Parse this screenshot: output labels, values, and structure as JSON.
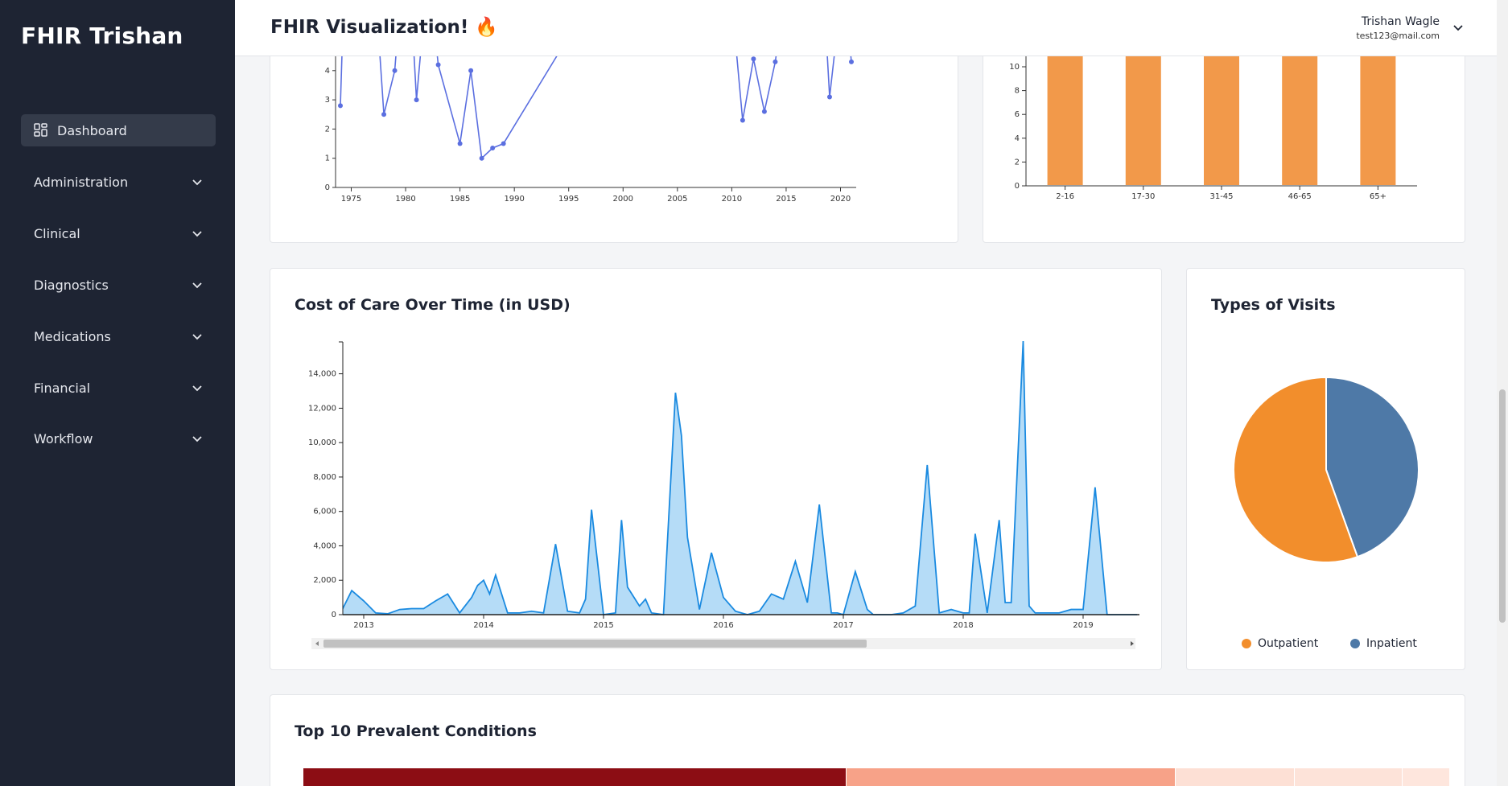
{
  "app": {
    "brand": "FHIR Trishan"
  },
  "header": {
    "title": "FHIR Visualization! 🔥",
    "user_name": "Trishan Wagle",
    "user_email": "test123@mail.com"
  },
  "sidebar": {
    "items": [
      {
        "label": "Dashboard",
        "icon": "dashboard-grid-icon",
        "active": true,
        "expandable": false
      },
      {
        "label": "Administration",
        "expandable": true
      },
      {
        "label": "Clinical",
        "expandable": true
      },
      {
        "label": "Diagnostics",
        "expandable": true
      },
      {
        "label": "Medications",
        "expandable": true
      },
      {
        "label": "Financial",
        "expandable": true
      },
      {
        "label": "Workflow",
        "expandable": true
      }
    ]
  },
  "cards": {
    "cost_title": "Cost of Care Over Time (in USD)",
    "visits_title": "Types of Visits",
    "conditions_title": "Top 10 Prevalent Conditions"
  },
  "colors": {
    "line": "#5b6fe0",
    "bar": "#f2994a",
    "area_fill": "#b5dcf7",
    "area_line": "#1a8ae0",
    "pie_outpatient": "#f28e2c",
    "pie_inpatient": "#4e79a7"
  },
  "chart_data": [
    {
      "type": "line",
      "x": [
        1974,
        1978,
        1979,
        1981,
        1983,
        1985,
        1986,
        1987,
        1988,
        1989,
        2011,
        2012,
        2013,
        2014,
        2019,
        2021
      ],
      "values": [
        2.8,
        2.5,
        4.0,
        3.0,
        4.2,
        1.5,
        4.0,
        1.0,
        1.35,
        1.5,
        2.3,
        4.4,
        2.6,
        4.3,
        3.1,
        4.3
      ],
      "xticks": [
        "1975",
        "1980",
        "1985",
        "1990",
        "1995",
        "2000",
        "2005",
        "2010",
        "2015",
        "2020"
      ],
      "yticks": [
        "0",
        "1",
        "2",
        "3",
        "4"
      ]
    },
    {
      "type": "bar",
      "categories": [
        "2-16",
        "17-30",
        "31-45",
        "46-65",
        "65+"
      ],
      "yticks": [
        "0",
        "2",
        "4",
        "6",
        "8",
        "10"
      ]
    },
    {
      "type": "area",
      "title": "Cost of Care Over Time (in USD)",
      "x": [
        2012.8,
        2012.9,
        2013.0,
        2013.1,
        2013.2,
        2013.3,
        2013.4,
        2013.5,
        2013.6,
        2013.7,
        2013.8,
        2013.9,
        2013.95,
        2014.0,
        2014.05,
        2014.1,
        2014.2,
        2014.3,
        2014.4,
        2014.5,
        2014.6,
        2014.7,
        2014.8,
        2014.85,
        2014.9,
        2015.0,
        2015.1,
        2015.15,
        2015.2,
        2015.3,
        2015.35,
        2015.4,
        2015.5,
        2015.6,
        2015.65,
        2015.7,
        2015.8,
        2015.9,
        2016.0,
        2016.1,
        2016.2,
        2016.3,
        2016.4,
        2016.5,
        2016.6,
        2016.7,
        2016.8,
        2016.9,
        2016.95,
        2017.0,
        2017.1,
        2017.2,
        2017.25,
        2017.3,
        2017.4,
        2017.5,
        2017.6,
        2017.7,
        2017.8,
        2017.9,
        2018.0,
        2018.05,
        2018.1,
        2018.2,
        2018.3,
        2018.35,
        2018.4,
        2018.5,
        2018.55,
        2018.6,
        2018.7,
        2018.75,
        2018.8,
        2018.9,
        2019.0,
        2019.1,
        2019.2,
        2019.3,
        2019.4,
        2019.45
      ],
      "values": [
        0,
        1400,
        800,
        100,
        50,
        300,
        350,
        350,
        800,
        1200,
        100,
        1000,
        1700,
        2000,
        1200,
        2300,
        100,
        100,
        200,
        100,
        4100,
        200,
        100,
        900,
        6100,
        0,
        100,
        5500,
        1600,
        500,
        900,
        100,
        0,
        12900,
        10400,
        4500,
        300,
        3600,
        1000,
        200,
        0,
        200,
        1200,
        900,
        3100,
        700,
        6400,
        100,
        100,
        0,
        2500,
        300,
        0,
        0,
        0,
        100,
        500,
        8700,
        100,
        300,
        100,
        100,
        4700,
        100,
        5500,
        700,
        700,
        15900,
        500,
        100,
        100,
        100,
        100,
        300,
        300,
        7400,
        0,
        0,
        0,
        0
      ],
      "xticks": [
        "2013",
        "2014",
        "2015",
        "2016",
        "2017",
        "2018",
        "2019"
      ],
      "yticks": [
        "0",
        "2,000",
        "4,000",
        "6,000",
        "8,000",
        "10,000",
        "12,000",
        "14,000"
      ]
    },
    {
      "type": "pie",
      "title": "Types of Visits",
      "categories": [
        "Outpatient",
        "Inpatient"
      ],
      "values": [
        55.5,
        44.5
      ]
    }
  ]
}
